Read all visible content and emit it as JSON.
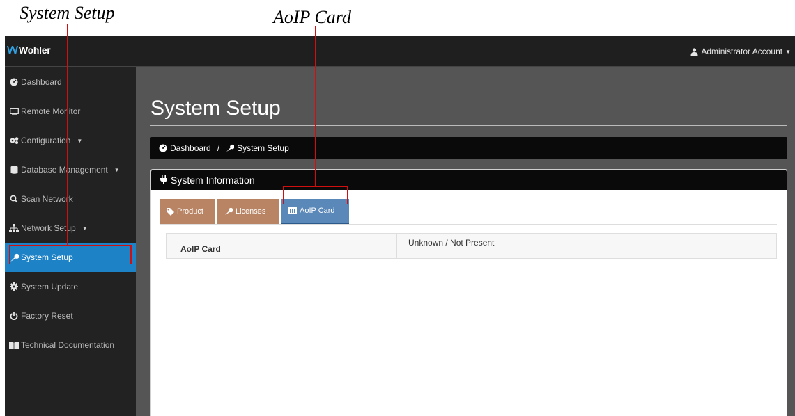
{
  "callouts": {
    "system_setup": "System Setup",
    "aoip_card": "AoIP Card"
  },
  "topbar": {
    "logo_text": "Wohler",
    "account_label": "Administrator Account"
  },
  "sidebar": {
    "items": [
      {
        "label": "Dashboard",
        "icon": "dashboard-icon"
      },
      {
        "label": "Remote Monitor",
        "icon": "monitor-icon"
      },
      {
        "label": "Configuration",
        "icon": "gears-icon"
      },
      {
        "label": "Database Management",
        "icon": "database-icon"
      },
      {
        "label": "Scan Network",
        "icon": "search-icon"
      },
      {
        "label": "Network Setup",
        "icon": "network-icon"
      },
      {
        "label": "System Setup",
        "icon": "wrench-icon"
      },
      {
        "label": "System Update",
        "icon": "gear-icon"
      },
      {
        "label": "Factory Reset",
        "icon": "power-icon"
      },
      {
        "label": "Technical Documentation",
        "icon": "book-icon"
      }
    ]
  },
  "main": {
    "title": "System Setup",
    "breadcrumb": {
      "home": "Dashboard",
      "separator": "/",
      "current": "System Setup"
    },
    "panel": {
      "title": "System Information",
      "tabs": [
        {
          "label": "Product"
        },
        {
          "label": "Licenses"
        },
        {
          "label": "AoIP Card"
        }
      ],
      "table": {
        "label": "AoIP Card",
        "value": "Unknown / Not Present"
      }
    }
  },
  "colors": {
    "active_nav": "#1e82c6",
    "tab_inactive": "#b98464",
    "tab_active": "#5a88b8",
    "callout": "#d10f0f"
  }
}
